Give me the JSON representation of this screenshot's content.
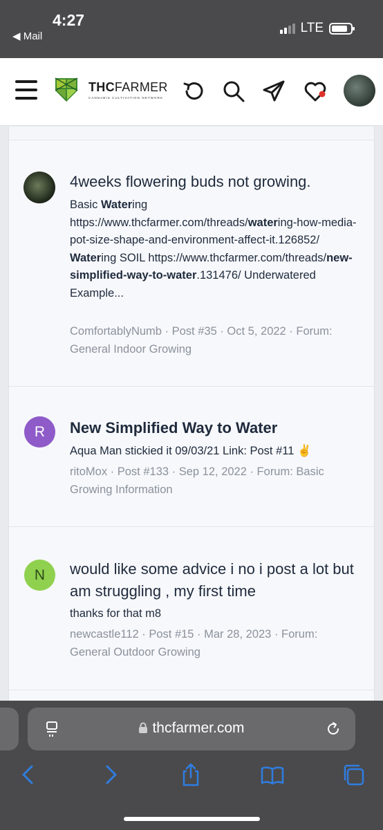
{
  "status_bar": {
    "time": "4:27",
    "back_app": "◀ Mail",
    "network": "LTE"
  },
  "header": {
    "logo_main_bold": "THC",
    "logo_main_light": "FARMER",
    "logo_sub": "CANNABIS CULTIVATION NETWORK",
    "icons": [
      "menu-icon",
      "history-icon",
      "search-icon",
      "send-icon",
      "heart-icon",
      "avatar"
    ],
    "notification_color": "#e0332b"
  },
  "results": [
    {
      "title": "4weeks flowering buds not growing.",
      "snippet_parts": [
        {
          "text": "Basic ",
          "bold": false
        },
        {
          "text": "Water",
          "bold": true
        },
        {
          "text": "ing https://www.thcfarmer.com/threads/",
          "bold": false
        },
        {
          "text": "water",
          "bold": true
        },
        {
          "text": "ing-how-media-pot-size-shape-and-environment-affect-it.126852/ ",
          "bold": false
        },
        {
          "text": "Water",
          "bold": true
        },
        {
          "text": "ing SOIL https://www.thcfarmer.com/threads/",
          "bold": false
        },
        {
          "text": "new-simplified-way-to-water",
          "bold": true
        },
        {
          "text": ".131476/ Underwatered Example...",
          "bold": false
        }
      ],
      "meta": "ComfortablyNumb · Post #35 · Oct 5, 2022 · Forum: General Indoor Growing"
    },
    {
      "title": "New Simplified Way to Water",
      "avatar_letter": "R",
      "avatar_color": "#8e5bc9",
      "snippet": "Aqua Man stickied it 09/03/21 Link: Post #11 ✌️",
      "meta": "ritoMox · Post #133 · Sep 12, 2022 · Forum: Basic Growing Information"
    },
    {
      "title": "would like some advice i no i post a lot but am struggling , my first time",
      "avatar_letter": "N",
      "avatar_color": "#8fd14f",
      "snippet": "thanks for that m8",
      "meta": "newcastle112 · Post #15 · Mar 28, 2023 · Forum: General Outdoor Growing"
    }
  ],
  "browser": {
    "url": "thcfarmer.com",
    "toolbar": [
      "back-icon",
      "forward-icon",
      "share-icon",
      "bookmarks-icon",
      "tabs-icon"
    ],
    "accent": "#2f7de1"
  }
}
